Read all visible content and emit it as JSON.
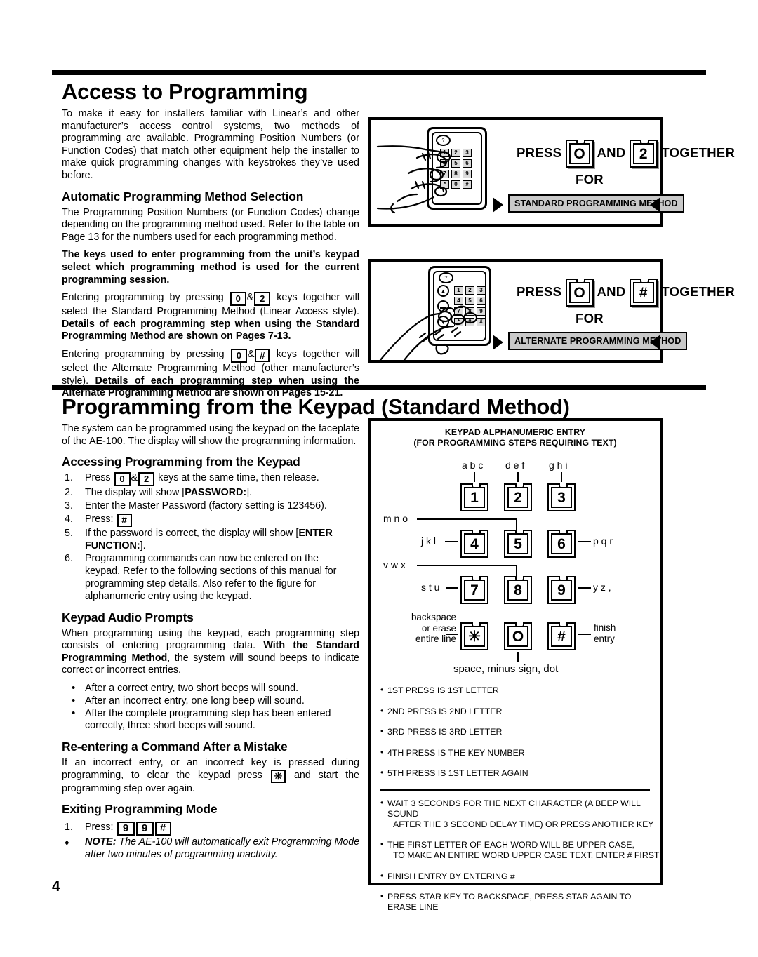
{
  "page_number": "4",
  "section1": {
    "title": "Access to Programming",
    "intro": "To make it easy for installers familiar with Linear’s and other manufacturer’s access control systems, two methods of programming are available. Programming Position Numbers (or Function Codes) that match other equipment help the installer to make quick programming changes with keystrokes they’ve used before.",
    "sub1": "Automatic Programming Method Selection",
    "para1": "The Programming Position Numbers (or Function Codes) change depending on the programming method used. Refer to the table on Page 13 for the numbers used for each programming method.",
    "para2_bold": "The keys used to enter programming from the unit’s keypad select which programming method is used for the current programming session.",
    "para3_a": "Entering programming by pressing",
    "para3_key1": "0",
    "para3_amp": "&",
    "para3_key2": "2",
    "para3_b": "keys together will select the Standard Programming Method (Linear Access style).",
    "para3_bold": "Details of each programming step when using the Standard Programming Method are shown on Pages 7-13.",
    "para4_a": "Entering programming by pressing",
    "para4_key1": "0",
    "para4_amp": "&",
    "para4_key2": "#",
    "para4_b": "keys together will select the Alternate Programming Method (other manufacturer’s style).",
    "para4_bold": "Details of each programming step when using the Alternate Programming Method are shown on Pages 15-21."
  },
  "fig_standard": {
    "press": "PRESS",
    "key1": "O",
    "and": "AND",
    "key2": "2",
    "together": "TOGETHER",
    "for": "FOR",
    "method": "STANDARD PROGRAMMING METHOD"
  },
  "fig_alternate": {
    "press": "PRESS",
    "key1": "O",
    "and": "AND",
    "key2": "#",
    "together": "TOGETHER",
    "for": "FOR",
    "method": "ALTERNATE PROGRAMMING METHOD"
  },
  "section2": {
    "title": "Programming from the Keypad (Standard Method)",
    "intro": "The system can be programmed using the keypad on the faceplate of the AE-100. The display will show the programming information.",
    "sub_access": "Accessing Programming from the Keypad",
    "steps": [
      {
        "num": "1.",
        "a": "Press",
        "key1": "0",
        "amp": "&",
        "key2": "2",
        "b": "keys at the same time, then release."
      },
      {
        "num": "2.",
        "a": "The display will show [",
        "bold": "PASSWORD:",
        "b": "]."
      },
      {
        "num": "3.",
        "a": "Enter the Master Password (factory setting is 123456)."
      },
      {
        "num": "4.",
        "a": "Press:",
        "key1": "#"
      },
      {
        "num": "5.",
        "a": "If the password is correct, the display will show [",
        "bold": "ENTER FUNCTION:",
        "b": "]."
      },
      {
        "num": "6.",
        "a": "Programming commands can now be entered on the keypad. Refer to the following sections of this manual for programming step details. Also refer to the figure for alphanumeric entry using the keypad."
      }
    ],
    "sub_audio": "Keypad Audio Prompts",
    "audio_intro_a": "When programming using the keypad, each programming step consists of entering programming data.",
    "audio_intro_bold": "With the Standard Programming Method",
    "audio_intro_b": ", the system will sound beeps to indicate correct or incorrect entries.",
    "audio_bullets": [
      "After a correct entry, two short beeps will sound.",
      "After an incorrect entry, one long beep will sound.",
      "After the complete programming step has been entered correctly, three short beeps will sound."
    ],
    "sub_reenter": "Re-entering a Command After a Mistake",
    "reenter_a": "If an incorrect entry, or an incorrect key is pressed during programming, to clear the keypad press",
    "reenter_key": "✳",
    "reenter_b": "and start the programming step over again.",
    "sub_exit": "Exiting Programming Mode",
    "exit_num": "1.",
    "exit_label": "Press:",
    "exit_keys": [
      "9",
      "9",
      "#"
    ],
    "note_label": "NOTE:",
    "note_text": "The AE-100 will automatically exit Programming Mode after two minutes of programming inactivity."
  },
  "fig_alpha": {
    "title_line1": "KEYPAD ALPHANUMERIC ENTRY",
    "title_line2": "(FOR PROGRAMMING STEPS REQUIRING TEXT)",
    "keys": {
      "k1": "1",
      "k2": "2",
      "k3": "3",
      "k4": "4",
      "k5": "5",
      "k6": "6",
      "k7": "7",
      "k8": "8",
      "k9": "9",
      "kstar": "✳",
      "k0": "O",
      "khash": "#"
    },
    "labels": {
      "abc": "a b c",
      "def": "d e f",
      "ghi": "g h i",
      "jkl": "j k l",
      "mno": "m n o",
      "pqr": "p q r",
      "stu": "s t u",
      "vwx": "v w x",
      "yz": "y z ,",
      "backspace_l1": "backspace",
      "backspace_l2": "or erase",
      "backspace_l3": "entire line",
      "finish_l1": "finish",
      "finish_l2": "entry",
      "zero_note": "space, minus sign, dot"
    },
    "bullets_top": [
      "1ST PRESS IS 1ST LETTER",
      "2ND PRESS IS 2ND LETTER",
      "3RD PRESS IS 3RD LETTER",
      "4TH PRESS IS THE KEY NUMBER",
      "5TH PRESS IS 1ST LETTER AGAIN"
    ],
    "bullets_bottom": [
      {
        "l1": "WAIT 3 SECONDS FOR THE NEXT CHARACTER (A BEEP WILL SOUND",
        "l2": "AFTER THE 3 SECOND DELAY TIME) OR PRESS ANOTHER KEY"
      },
      {
        "l1": "THE FIRST LETTER OF EACH WORD WILL BE UPPER CASE,",
        "l2": "TO MAKE AN ENTIRE WORD UPPER CASE TEXT, ENTER # FIRST"
      },
      {
        "l1": "FINISH ENTRY BY ENTERING #"
      },
      {
        "l1": "PRESS STAR KEY TO BACKSPACE, PRESS STAR AGAIN TO ERASE LINE"
      }
    ]
  },
  "keypad_art": {
    "keys": [
      "1",
      "2",
      "3",
      "4",
      "5",
      "6",
      "7",
      "8",
      "9",
      "*",
      "0",
      "#"
    ],
    "fn_keys": [
      "▲",
      "▬",
      "▼"
    ],
    "led": "?"
  },
  "colors": {
    "ink": "#000000",
    "band_fill": "#c9c9c9",
    "minikey_fill": "#dcdcdc"
  }
}
